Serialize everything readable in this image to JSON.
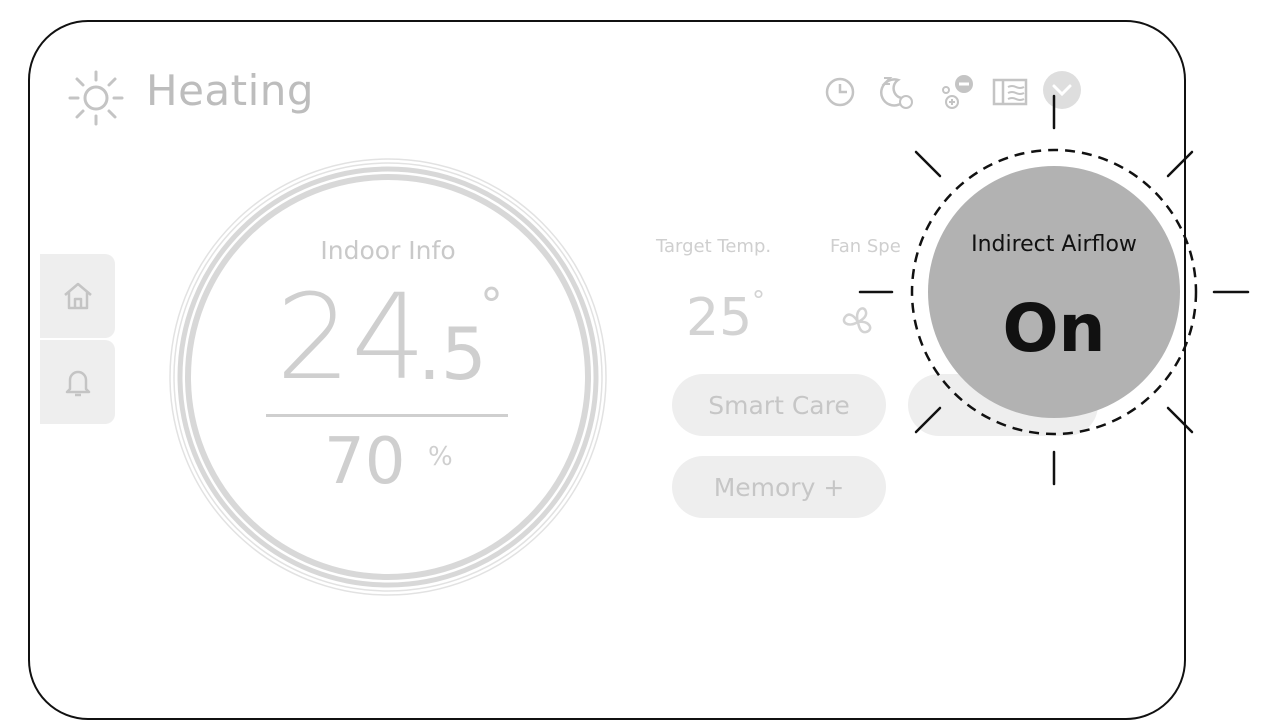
{
  "header": {
    "mode_icon": "sun-icon",
    "mode_label": "Heating",
    "icons": [
      "clock-icon",
      "sleep-timer-icon",
      "energy-control-icon",
      "airflow-settings-icon",
      "chevron-down-icon"
    ]
  },
  "side_nav": {
    "items": [
      {
        "icon": "home-icon"
      },
      {
        "icon": "bell-icon"
      }
    ]
  },
  "indoor": {
    "title": "Indoor Info",
    "temp_int": "24",
    "temp_dec": ".5",
    "temp_unit": "°",
    "humidity": "70",
    "humidity_unit": "%"
  },
  "controls": {
    "target_label": "Target Temp.",
    "target_value": "25",
    "target_unit": "°",
    "fan_label": "Fan Spe",
    "fan_icon": "fan-icon",
    "buttons": [
      "Smart Care",
      "Memory +"
    ]
  },
  "callout": {
    "title": "Indirect Airflow",
    "value": "On"
  },
  "colors": {
    "faded_text": "#cfcfcf",
    "pill_bg": "#eeeeee",
    "callout_bg": "#b2b2b2",
    "frame": "#111111"
  }
}
